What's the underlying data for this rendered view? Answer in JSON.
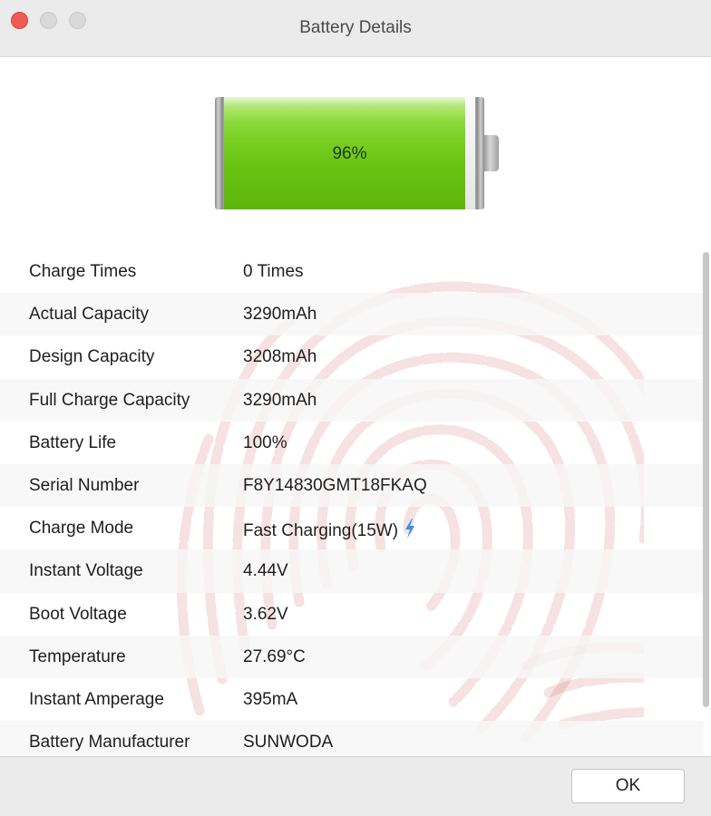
{
  "window": {
    "title": "Battery Details"
  },
  "battery": {
    "level_percent": 96,
    "label": "96%",
    "fill_color": "#6fc814"
  },
  "details": [
    {
      "label": "Charge Times",
      "value": "0 Times"
    },
    {
      "label": "Actual Capacity",
      "value": "3290mAh"
    },
    {
      "label": "Design Capacity",
      "value": "3208mAh"
    },
    {
      "label": "Full Charge Capacity",
      "value": "3290mAh"
    },
    {
      "label": "Battery Life",
      "value": "100%"
    },
    {
      "label": "Serial Number",
      "value": "F8Y14830GMT18FKAQ"
    },
    {
      "label": "Charge Mode",
      "value": "Fast Charging(15W)",
      "icon": "lightning-bolt-icon"
    },
    {
      "label": "Instant Voltage",
      "value": "4.44V"
    },
    {
      "label": "Boot Voltage",
      "value": "3.62V"
    },
    {
      "label": "Temperature",
      "value": "27.69°C"
    },
    {
      "label": "Instant Amperage",
      "value": "395mA"
    },
    {
      "label": "Battery Manufacturer",
      "value": "SUNWODA"
    }
  ],
  "footer": {
    "ok_label": "OK"
  },
  "colors": {
    "close_light": "#ee5b55",
    "watermark": "#c84848",
    "bolt": "#3d8ff0"
  }
}
